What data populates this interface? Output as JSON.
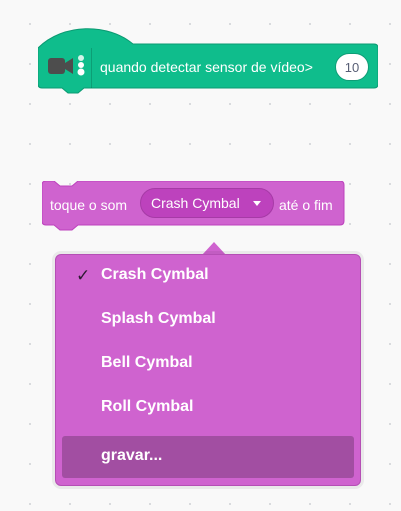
{
  "hat_block": {
    "label": "quando detectar sensor de vídeo>",
    "value": "10",
    "icon": "video-sensing-icon",
    "color": "#0fbd8c"
  },
  "sound_block": {
    "prefix": "toque o som",
    "selected_sound": "Crash Cymbal",
    "suffix": "até o fim",
    "color": "#cf63cf"
  },
  "dropdown_menu": {
    "items": [
      {
        "label": "Crash Cymbal",
        "checked": true
      },
      {
        "label": "Splash Cymbal",
        "checked": false
      },
      {
        "label": "Bell Cymbal",
        "checked": false
      },
      {
        "label": "Roll Cymbal",
        "checked": false
      },
      {
        "label": "gravar...",
        "checked": false,
        "hovered": true
      }
    ],
    "check_glyph": "✓"
  }
}
